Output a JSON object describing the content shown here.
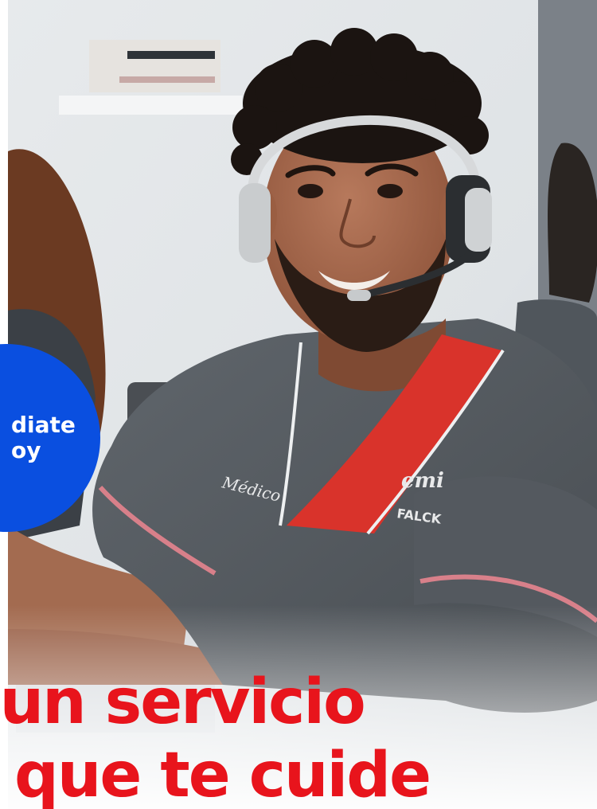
{
  "badge": {
    "line1": "diate",
    "line2": "oy"
  },
  "headline": {
    "line1": "s un servicio",
    "line2": "que te cuide"
  },
  "scrubs": {
    "left_text": "Médico",
    "right_text": "emi",
    "right_sub": "FALCK"
  },
  "colors": {
    "brand_blue": "#0a4fe0",
    "brand_red": "#e8141c",
    "scrub_gray": "#545a60"
  }
}
